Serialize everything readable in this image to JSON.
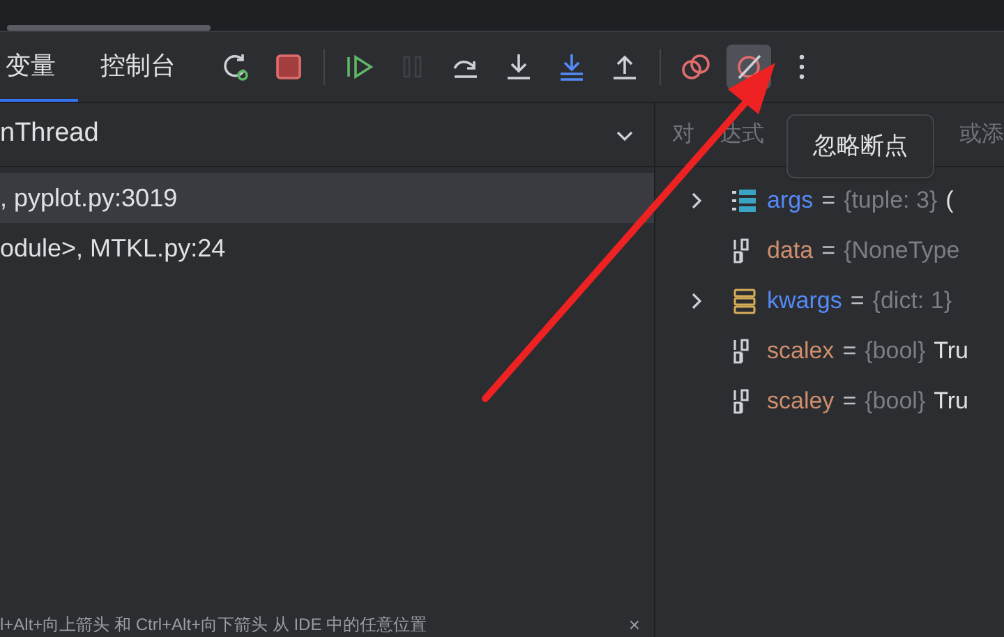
{
  "tabs": [
    {
      "label": "变量",
      "selected": true
    },
    {
      "label": "控制台",
      "selected": false
    }
  ],
  "toolbar": [
    [
      {
        "kind": "rerun",
        "disabled": false,
        "selected": false
      },
      {
        "kind": "stop",
        "disabled": false,
        "selected": false
      }
    ],
    [
      {
        "kind": "resume",
        "disabled": false,
        "selected": false
      },
      {
        "kind": "pause",
        "disabled": true,
        "selected": false
      },
      {
        "kind": "step-over",
        "disabled": false,
        "selected": false
      },
      {
        "kind": "step-into",
        "disabled": false,
        "selected": false
      },
      {
        "kind": "step-into-my-code",
        "disabled": false,
        "selected": false
      },
      {
        "kind": "step-out",
        "disabled": false,
        "selected": false
      }
    ],
    [
      {
        "kind": "breakpoints",
        "disabled": false,
        "selected": false
      },
      {
        "kind": "mute-breakpoints",
        "disabled": false,
        "selected": true
      },
      {
        "kind": "more",
        "disabled": false,
        "selected": false
      }
    ]
  ],
  "thread_dropdown": {
    "value": "nThread"
  },
  "frames": [
    {
      "label": ", pyplot.py:3019",
      "selected": true
    },
    {
      "label": "odule>, MTKL.py:24",
      "selected": false
    }
  ],
  "eval_field": {
    "placeholder_parts": [
      "对",
      "达式",
      "或添"
    ]
  },
  "tooltip": "忽略断点",
  "variables": [
    {
      "kind": "list",
      "name": "args",
      "separator": "=",
      "type": "{tuple: 3}",
      "value": "(",
      "expandable": true
    },
    {
      "kind": "plain",
      "name": "data",
      "separator": "=",
      "type": "{NoneType",
      "expandable": false
    },
    {
      "kind": "dict",
      "name": "kwargs",
      "separator": "=",
      "type": "{dict: 1}",
      "expandable": true
    },
    {
      "kind": "plain",
      "name": "scalex",
      "separator": "=",
      "type": "{bool}",
      "value": "Tru",
      "expandable": false
    },
    {
      "kind": "plain",
      "name": "scaley",
      "separator": "=",
      "type": "{bool}",
      "value": "Tru",
      "expandable": false
    }
  ],
  "hint": {
    "text": "l+Alt+向上箭头 和 Ctrl+Alt+向下箭头 从 IDE 中的任意位置",
    "close": "×"
  }
}
